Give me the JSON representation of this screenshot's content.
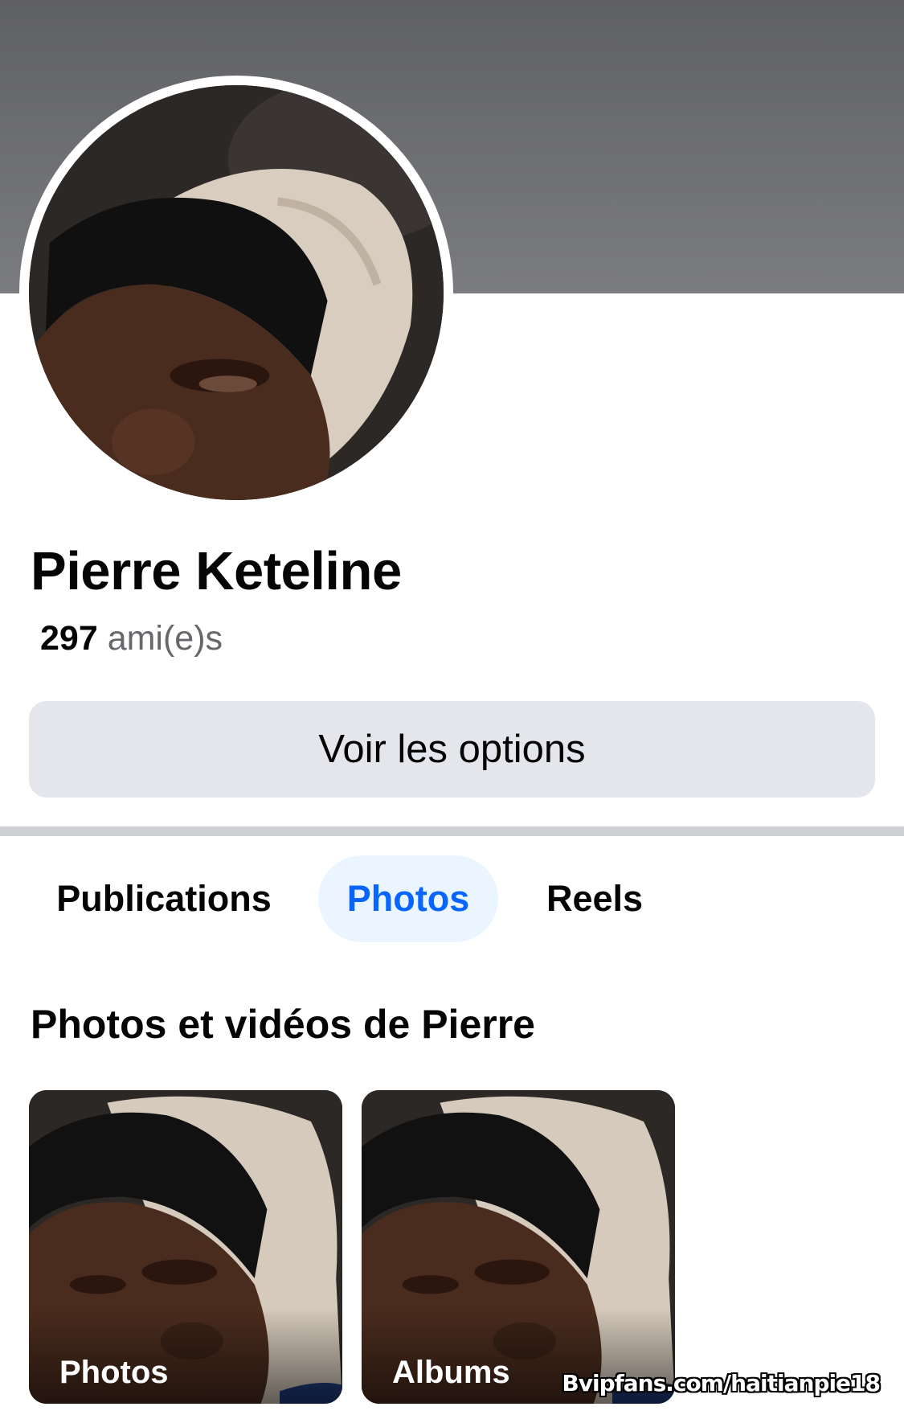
{
  "profile": {
    "name": "Pierre Keteline",
    "friends_count": "297",
    "friends_label": "ami(e)s",
    "avatar_icon": "profile-photo"
  },
  "actions": {
    "options_label": "Voir les options"
  },
  "tabs": [
    {
      "label": "Publications",
      "active": false
    },
    {
      "label": "Photos",
      "active": true
    },
    {
      "label": "Reels",
      "active": false
    }
  ],
  "media_section": {
    "title": "Photos et vidéos de Pierre",
    "tiles": [
      {
        "label": "Photos"
      },
      {
        "label": "Albums"
      }
    ]
  },
  "watermark": "Bvipfans.com/haitianpie18",
  "colors": {
    "accent": "#0866ff",
    "active_tab_bg": "#ebf5ff",
    "button_bg": "#e4e6eb",
    "secondary_text": "#65676b"
  }
}
